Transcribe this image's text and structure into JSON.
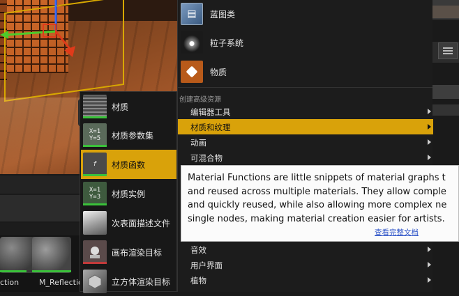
{
  "basic_items": [
    {
      "label": "蓝图类",
      "icon": "blueprint-icon"
    },
    {
      "label": "粒子系统",
      "icon": "particle-system-icon"
    },
    {
      "label": "物质",
      "icon": "material-icon"
    }
  ],
  "section_header": "创建高级资源",
  "advanced_items": [
    {
      "label": "编辑器工具",
      "has_submenu": true
    },
    {
      "label": "材质和纹理",
      "has_submenu": true,
      "active": true
    },
    {
      "label": "动画",
      "has_submenu": true
    },
    {
      "label": "可混合物",
      "has_submenu": true
    },
    {
      "label": "音效",
      "has_submenu": true
    },
    {
      "label": "用户界面",
      "has_submenu": true
    },
    {
      "label": "植物",
      "has_submenu": true
    }
  ],
  "submenu_items": [
    {
      "label": "材质",
      "thumb_text": "",
      "icon": "material-grid-icon"
    },
    {
      "label": "材质参数集",
      "thumb_text": "X=1 Y=5",
      "icon": "material-parameter-collection-icon"
    },
    {
      "label": "材质函数",
      "thumb_text": "f",
      "icon": "material-function-icon",
      "active": true
    },
    {
      "label": "材质实例",
      "thumb_text": "X=1 Y=3",
      "icon": "material-instance-icon"
    },
    {
      "label": "次表面描述文件",
      "thumb_text": "",
      "icon": "subsurface-profile-icon"
    },
    {
      "label": "画布渲染目标",
      "thumb_text": "",
      "icon": "canvas-render-target-icon"
    },
    {
      "label": "立方体渲染目标",
      "thumb_text": "",
      "icon": "cube-render-target-icon"
    }
  ],
  "tooltip": {
    "text": "Material Functions are little snippets of material graphs t\nand reused across multiple materials. They allow comple\nand quickly reused, while also allowing more complex ne\nsingle nodes, making material creation easier for artists.",
    "link": "查看完整文档"
  },
  "content_browser": {
    "assets": [
      {
        "label": "ction"
      },
      {
        "label": "M_Reflection"
      }
    ]
  },
  "colors": {
    "highlight": "#d9a20a",
    "menu_bg": "#1c1c1c",
    "link": "#2f55c8",
    "asset_bar": "#3ac23a"
  }
}
